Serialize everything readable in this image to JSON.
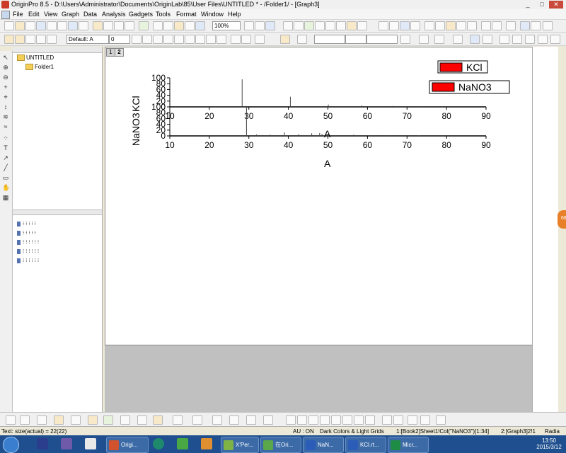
{
  "window": {
    "title": "OriginPro 8.5 - D:\\Users\\Administrator\\Documents\\OriginLab\\85\\User Files\\UNTITLED * - /Folder1/ - [Graph3]",
    "minimize": "_",
    "restore": "□",
    "close": "✕"
  },
  "menu": {
    "items": [
      "File",
      "Edit",
      "View",
      "Graph",
      "Data",
      "Analysis",
      "Gadgets",
      "Tools",
      "Format",
      "Window",
      "Help"
    ]
  },
  "toolbar": {
    "zoom": "100%",
    "font": "Default: A",
    "font_size": "0"
  },
  "explorer": {
    "root": "UNTITLED",
    "folder": "Folder1"
  },
  "graph": {
    "layer_tab_1": "1",
    "layer_tab_2": "2",
    "legend_kcl": "KCl",
    "legend_nano3": "NaNO3",
    "ylabel_kcl": "KCl",
    "ylabel_nano3": "NaNO3",
    "xlabel_mid": "A",
    "xlabel_bottom": "A",
    "series_color": "#ff0000"
  },
  "chart_data": [
    {
      "type": "bar",
      "name": "KCl",
      "x": [
        28.3,
        40.5,
        50.1,
        58.6,
        66.3,
        73.6
      ],
      "y": [
        95,
        35,
        8,
        5,
        3,
        2
      ],
      "xlim": [
        10,
        90
      ],
      "ylim": [
        0,
        100
      ],
      "xticks": [
        10,
        20,
        30,
        40,
        50,
        60,
        70,
        80,
        90
      ],
      "yticks": [
        0,
        20,
        40,
        60,
        80,
        100
      ]
    },
    {
      "type": "bar",
      "name": "NaNO3",
      "x": [
        23,
        29.4,
        31.9,
        35.4,
        39,
        42.6,
        45.9,
        47.9,
        48.5,
        56.5,
        60.8,
        64.9,
        73
      ],
      "y": [
        3,
        100,
        5,
        4,
        12,
        6,
        9,
        10,
        7,
        4,
        2,
        2,
        1
      ],
      "xlim": [
        10,
        90
      ],
      "ylim": [
        0,
        100
      ],
      "xticks": [
        10,
        20,
        30,
        40,
        50,
        60,
        70,
        80,
        90
      ],
      "yticks": [
        0,
        20,
        40,
        60,
        80,
        100
      ]
    }
  ],
  "status": {
    "left": "Text: size(actual) = 22(22)",
    "au": "AU : ON",
    "theme": "Dark Colors & Light Grids",
    "cell": "1:[Book2]Sheet1!Col(\"NaNO3\")[1:34]",
    "graph": "2:[Graph3]2!1",
    "unit": "Radia"
  },
  "taskbar": {
    "buttons": [
      "Origi...",
      "X'Per...",
      "在Ori...",
      "NaN...",
      "KCl.rt...",
      "Micr..."
    ],
    "time": "13:50",
    "date": "2015/3/12"
  },
  "gadget": {
    "badge": "68"
  }
}
